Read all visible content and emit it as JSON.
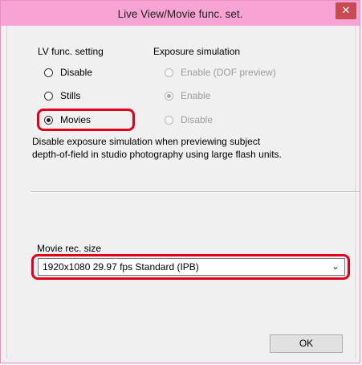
{
  "window": {
    "title": "Live View/Movie func. set.",
    "close_glyph": "✕",
    "accent_color": "#f7a3d3"
  },
  "lv_func": {
    "label": "LV func. setting",
    "options": [
      {
        "label": "Disable",
        "selected": false
      },
      {
        "label": "Stills",
        "selected": false
      },
      {
        "label": "Movies",
        "selected": true
      }
    ]
  },
  "exposure_sim": {
    "label": "Exposure simulation",
    "options": [
      {
        "label": "Enable (DOF preview)",
        "selected": false,
        "disabled": true
      },
      {
        "label": "Enable",
        "selected": true,
        "disabled": true
      },
      {
        "label": "Disable",
        "selected": false,
        "disabled": true
      }
    ]
  },
  "description": {
    "line1": "Disable exposure simulation when previewing subject",
    "line2": "depth-of-field in studio photography using large flash units."
  },
  "movie_rec": {
    "label": "Movie rec. size",
    "value": "1920x1080  29.97 fps Standard (IPB)"
  },
  "buttons": {
    "ok": "OK"
  },
  "highlight_color": "#e0001b"
}
